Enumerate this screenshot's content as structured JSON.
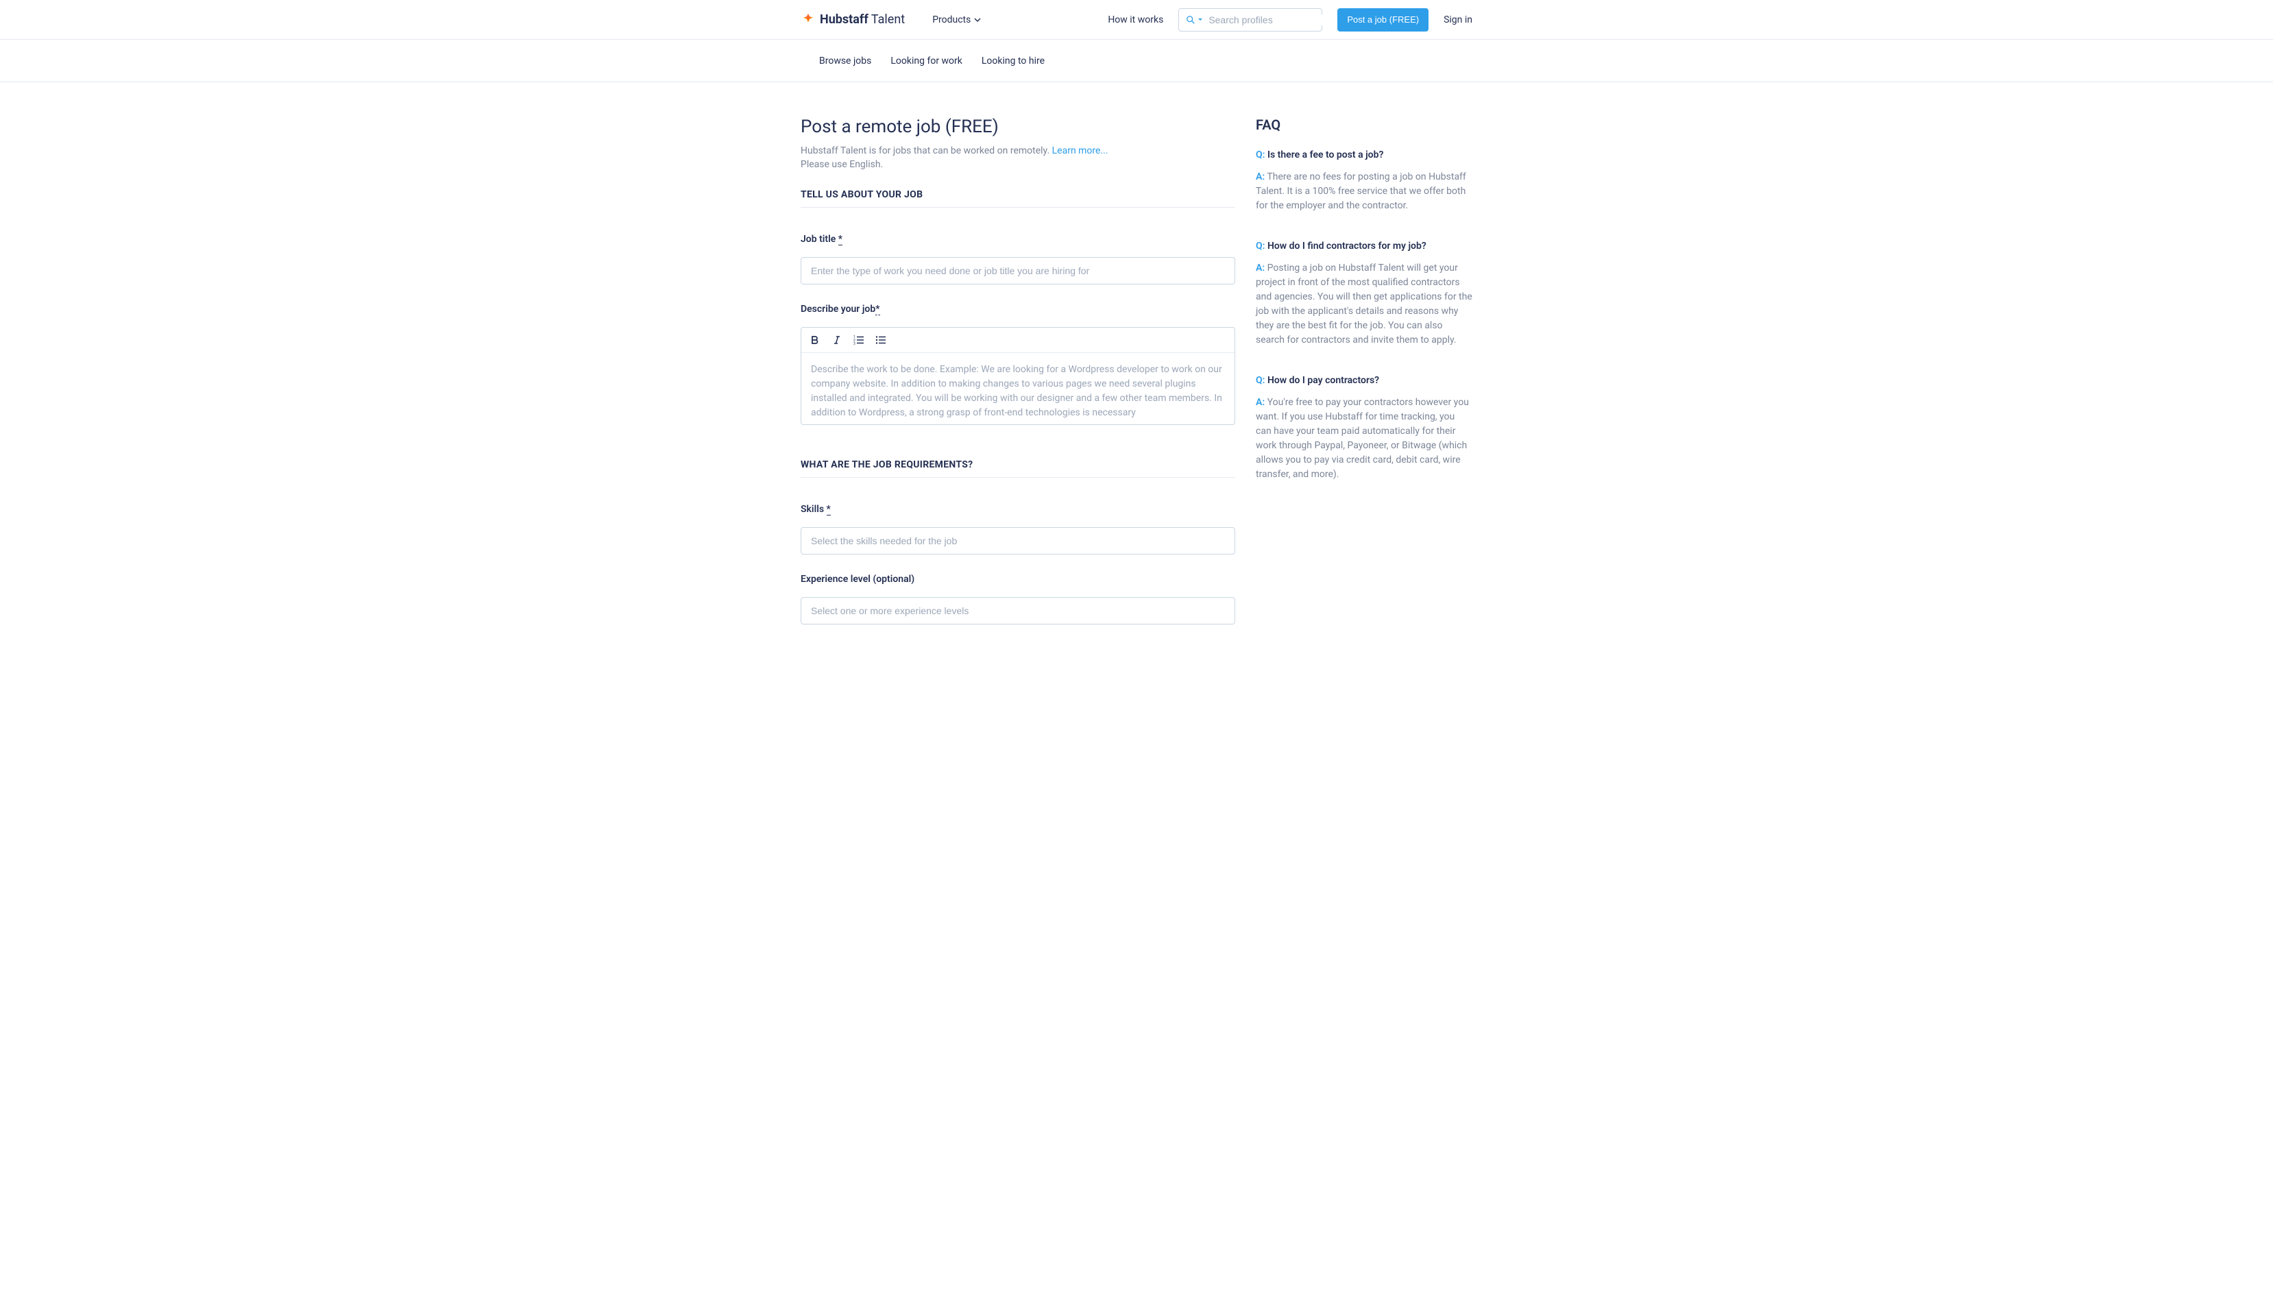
{
  "header": {
    "logo_bold": "Hubstaff",
    "logo_normal": " Talent",
    "products": "Products",
    "how_it_works": "How it works",
    "search_placeholder": "Search profiles",
    "post_job_btn": "Post a job (FREE)",
    "sign_in": "Sign in"
  },
  "subnav": {
    "browse_jobs": "Browse jobs",
    "looking_for_work": "Looking for work",
    "looking_to_hire": "Looking to hire"
  },
  "page": {
    "title": "Post a remote job (FREE)",
    "subtitle": "Hubstaff Talent is for jobs that can be worked on remotely. ",
    "learn_more": "Learn more...",
    "subtitle2": "Please use English."
  },
  "form": {
    "section1_title": "TELL US ABOUT YOUR JOB",
    "job_title_label": "Job title ",
    "job_title_required": "*",
    "job_title_placeholder": "Enter the type of work you need done or job title you are hiring for",
    "describe_label": "Describe your job",
    "describe_required": "*",
    "describe_placeholder": "Describe the work to be done. Example: We are looking for a Wordpress developer to work on our company website. In addition to making changes to various pages we need several plugins installed and integrated. You will be working with our designer and a few other team members. In addition to Wordpress, a strong grasp of front-end technologies is necessary",
    "section2_title": "WHAT ARE THE JOB REQUIREMENTS?",
    "skills_label": "Skills ",
    "skills_required": "*",
    "skills_placeholder": "Select the skills needed for the job",
    "experience_label": "Experience level (optional)",
    "experience_placeholder": "Select one or more experience levels"
  },
  "faq": {
    "title": "FAQ",
    "q_label": "Q:",
    "a_label": "A:",
    "items": [
      {
        "q": "Is there a fee to post a job?",
        "a": "There are no fees for posting a job on Hubstaff Talent. It is a 100% free service that we offer both for the employer and the contractor."
      },
      {
        "q": "How do I find contractors for my job?",
        "a": "Posting a job on Hubstaff Talent will get your project in front of the most qualified contractors and agencies. You will then get applications for the job with the applicant's details and reasons why they are the best fit for the job. You can also search for contractors and invite them to apply."
      },
      {
        "q": "How do I pay contractors?",
        "a": "You're free to pay your contractors however you want. If you use Hubstaff for time tracking, you can have your team paid automatically for their work through Paypal, Payoneer, or Bitwage (which allows you to pay via credit card, debit card, wire transfer, and more)."
      }
    ]
  }
}
